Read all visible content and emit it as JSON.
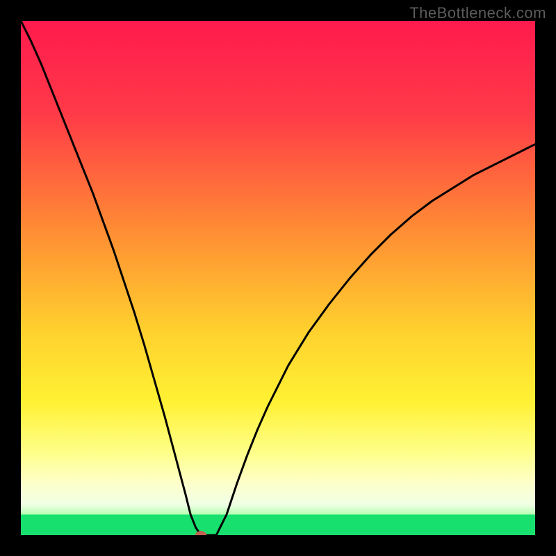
{
  "watermark": "TheBottleneck.com",
  "chart_data": {
    "type": "line",
    "title": "",
    "xlabel": "",
    "ylabel": "",
    "xlim": [
      0,
      100
    ],
    "ylim": [
      0,
      100
    ],
    "x": [
      0,
      2,
      4,
      6,
      8,
      10,
      12,
      14,
      16,
      18,
      20,
      22,
      24,
      26,
      28,
      30,
      32,
      33,
      34,
      35,
      36,
      38,
      40,
      42,
      44,
      46,
      48,
      50,
      52,
      56,
      60,
      64,
      68,
      72,
      76,
      80,
      84,
      88,
      92,
      96,
      100
    ],
    "values": [
      100,
      96,
      91.5,
      86.5,
      81.5,
      76.5,
      71.5,
      66.5,
      61,
      55.5,
      49.5,
      43.5,
      37,
      30,
      23,
      15.5,
      8,
      4,
      1.5,
      0,
      0,
      0,
      4,
      10,
      15.5,
      20.5,
      25,
      29,
      33,
      39.5,
      45,
      50,
      54.5,
      58.5,
      62,
      65,
      67.5,
      70,
      72,
      74,
      76
    ],
    "marker": {
      "x": 35,
      "y": 0
    },
    "green_band_top": 4,
    "gradient_stops": [
      {
        "offset": 0,
        "color": "#ff1a4d"
      },
      {
        "offset": 18,
        "color": "#ff3a48"
      },
      {
        "offset": 40,
        "color": "#ff8a34"
      },
      {
        "offset": 60,
        "color": "#ffd02e"
      },
      {
        "offset": 74,
        "color": "#fff133"
      },
      {
        "offset": 84,
        "color": "#ffff8a"
      },
      {
        "offset": 90,
        "color": "#fdffcb"
      },
      {
        "offset": 94,
        "color": "#f0ffe5"
      },
      {
        "offset": 96,
        "color": "#b8ffb3"
      },
      {
        "offset": 98,
        "color": "#57f18e"
      },
      {
        "offset": 100,
        "color": "#18e06e"
      }
    ]
  }
}
